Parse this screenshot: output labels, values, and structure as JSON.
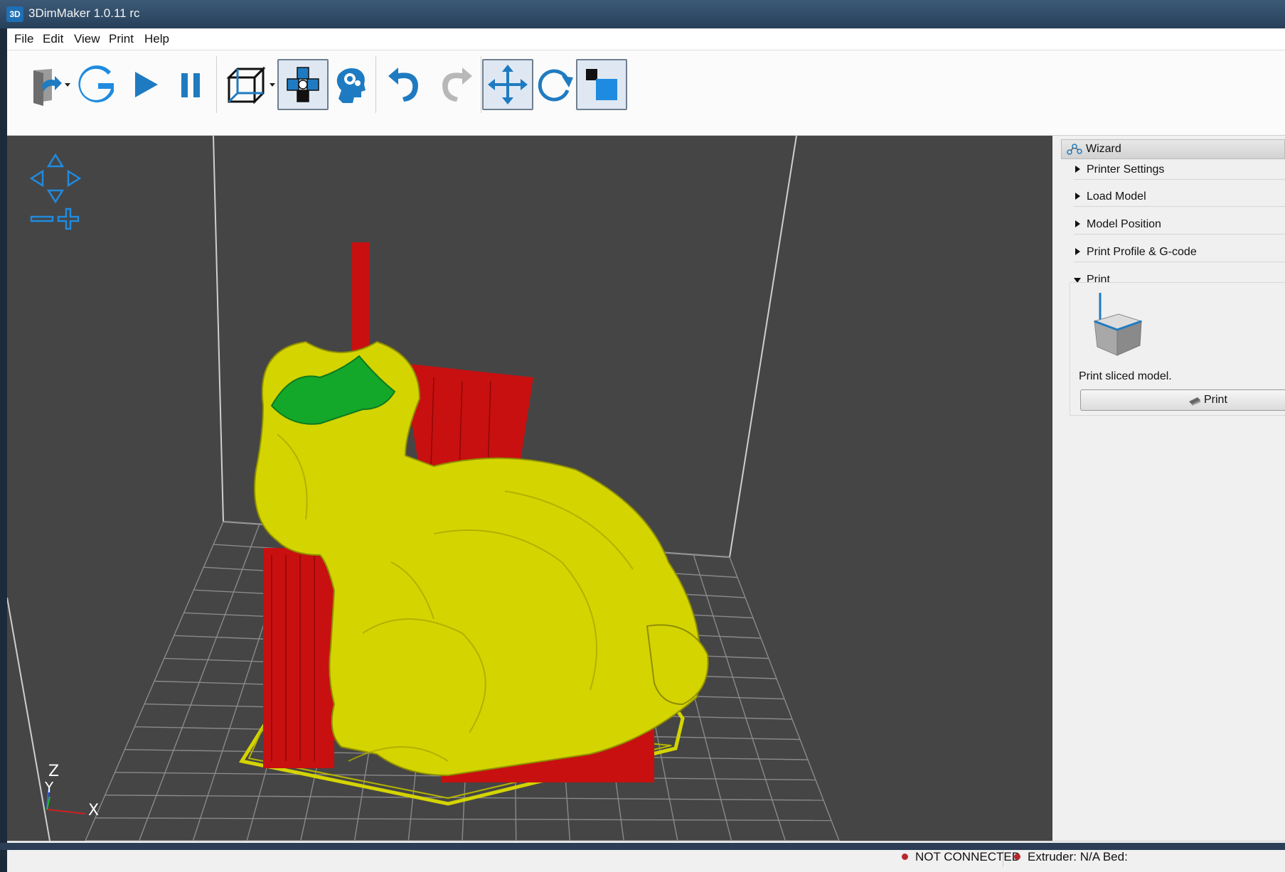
{
  "window": {
    "app_icon_text": "3D",
    "title": "3DimMaker 1.0.11 rc"
  },
  "menu": [
    "File",
    "Edit",
    "View",
    "Print",
    "Help"
  ],
  "toolbar": [
    {
      "name": "open-file-icon",
      "pressed": false,
      "dropdown": true
    },
    {
      "name": "gcode-icon",
      "pressed": false,
      "dropdown": false
    },
    {
      "name": "play-icon",
      "pressed": false,
      "dropdown": false
    },
    {
      "name": "pause-icon",
      "pressed": false,
      "dropdown": false
    },
    {
      "name": "view-cube-icon",
      "pressed": false,
      "dropdown": true
    },
    {
      "name": "slice-layers-icon",
      "pressed": true,
      "dropdown": false
    },
    {
      "name": "head-settings-icon",
      "pressed": false,
      "dropdown": false
    },
    {
      "name": "undo-icon",
      "pressed": false,
      "dropdown": false
    },
    {
      "name": "redo-icon",
      "pressed": false,
      "dropdown": false
    },
    {
      "name": "move-icon",
      "pressed": true,
      "dropdown": false
    },
    {
      "name": "rotate-icon",
      "pressed": false,
      "dropdown": false
    },
    {
      "name": "scale-icon",
      "pressed": true,
      "dropdown": false
    }
  ],
  "viewport": {
    "background": "#454545",
    "model_color": "#d4d400",
    "support_color": "#c81010",
    "top_layer_color": "#13a82a",
    "grid_color": "#8a8a8a",
    "axes": {
      "z": "Z",
      "y": "Y",
      "x": "X"
    }
  },
  "wizard": {
    "title": "Wizard",
    "sections": [
      {
        "label": "Printer Settings",
        "expanded": false
      },
      {
        "label": "Load Model",
        "expanded": false
      },
      {
        "label": "Model Position",
        "expanded": false
      },
      {
        "label": "Print Profile & G-code",
        "expanded": false
      },
      {
        "label": "Print",
        "expanded": true
      }
    ],
    "print_description": "Print sliced model.",
    "print_button": "Print"
  },
  "status": {
    "connection": "NOT CONNECTED",
    "extruder": "Extruder: N/A Bed:"
  }
}
